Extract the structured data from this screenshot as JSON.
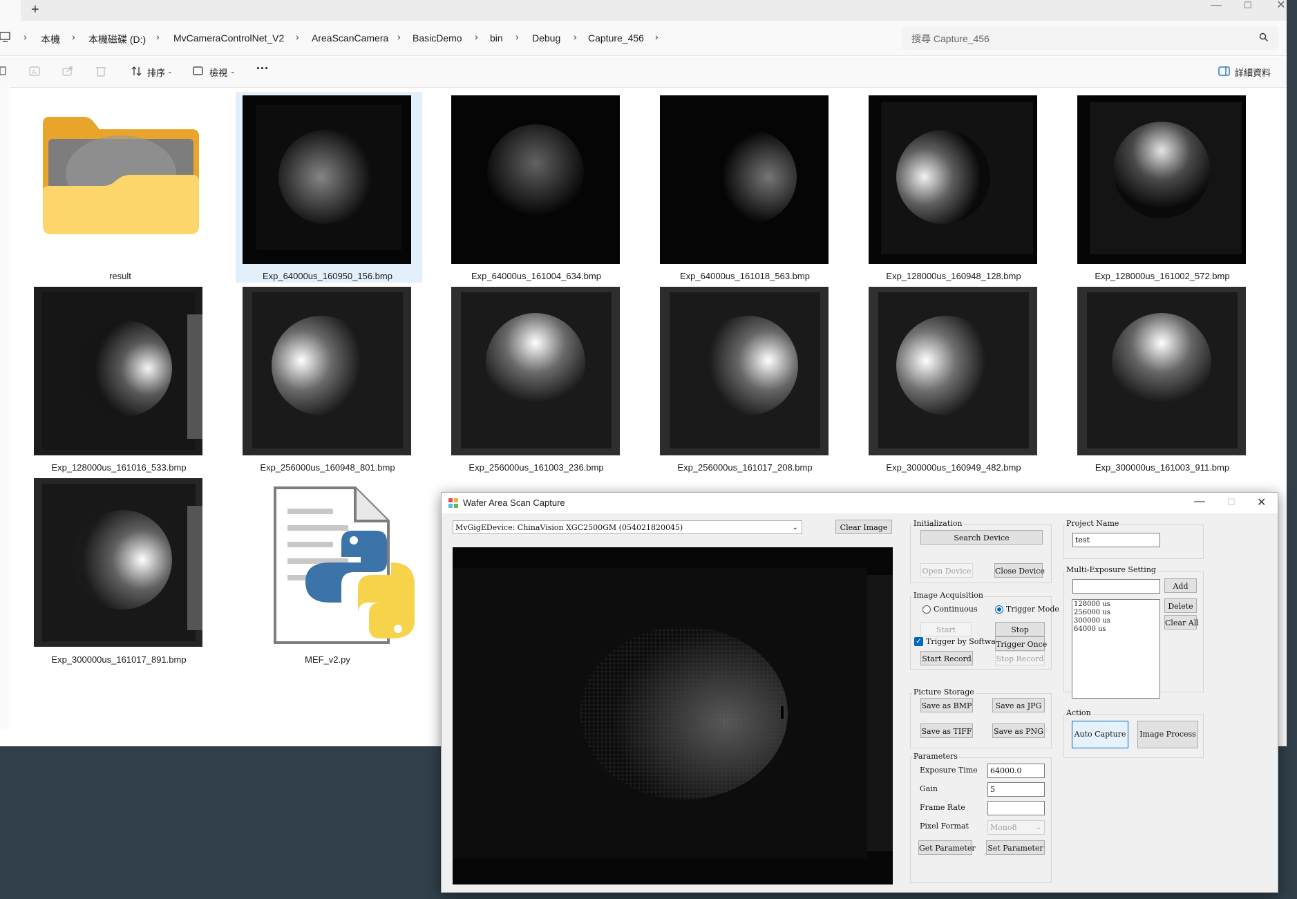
{
  "explorer": {
    "breadcrumb": [
      "本機",
      "本機磁碟 (D:)",
      "MvCameraControlNet_V2",
      "AreaScanCamera",
      "BasicDemo",
      "bin",
      "Debug",
      "Capture_456"
    ],
    "search_placeholder": "搜尋 Capture_456",
    "toolbar": {
      "sort_label": "排序",
      "view_label": "檢視",
      "more_label": "···",
      "details_label": "詳細資料"
    },
    "files": [
      {
        "name": "result",
        "kind": "folder"
      },
      {
        "name": "Exp_64000us_160950_156.bmp",
        "kind": "image",
        "brightness": 0.25,
        "selected": true
      },
      {
        "name": "Exp_64000us_161004_634.bmp",
        "kind": "image",
        "brightness": 0.18
      },
      {
        "name": "Exp_64000us_161018_563.bmp",
        "kind": "image",
        "brightness": 0.22
      },
      {
        "name": "Exp_128000us_160948_128.bmp",
        "kind": "image",
        "brightness": 0.45
      },
      {
        "name": "Exp_128000us_161002_572.bmp",
        "kind": "image",
        "brightness": 0.4
      },
      {
        "name": "Exp_128000us_161016_533.bmp",
        "kind": "image",
        "brightness": 0.45
      },
      {
        "name": "Exp_256000us_160948_801.bmp",
        "kind": "image",
        "brightness": 0.6
      },
      {
        "name": "Exp_256000us_161003_236.bmp",
        "kind": "image",
        "brightness": 0.6
      },
      {
        "name": "Exp_256000us_161017_208.bmp",
        "kind": "image",
        "brightness": 0.6
      },
      {
        "name": "Exp_300000us_160949_482.bmp",
        "kind": "image",
        "brightness": 0.65
      },
      {
        "name": "Exp_300000us_161003_911.bmp",
        "kind": "image",
        "brightness": 0.6
      },
      {
        "name": "Exp_300000us_161017_891.bmp",
        "kind": "image",
        "brightness": 0.6
      },
      {
        "name": "MEF_v2.py",
        "kind": "python"
      }
    ]
  },
  "app": {
    "title": "Wafer Area Scan Capture",
    "device_select": "MvGigEDevice: ChinaVision XGC2500GM (054021820045)",
    "clear_image": "Clear Image",
    "initialization": {
      "label": "Initialization",
      "search": "Search Device",
      "open": "Open Device",
      "close": "Close Device"
    },
    "acquisition": {
      "label": "Image Acquisition",
      "continuous": "Continuous",
      "trigger_mode": "Trigger Mode",
      "start": "Start",
      "stop": "Stop",
      "trigger_software": "Trigger by Software",
      "trigger_once": "Trigger Once",
      "start_record": "Start Record",
      "stop_record": "Stop Record"
    },
    "storage": {
      "label": "Picture Storage",
      "bmp": "Save as BMP",
      "jpg": "Save as JPG",
      "tiff": "Save as TIFF",
      "png": "Save as PNG"
    },
    "parameters": {
      "label": "Parameters",
      "exposure_label": "Exposure Time",
      "exposure_value": "64000.0",
      "gain_label": "Gain",
      "gain_value": "5",
      "frame_rate_label": "Frame Rate",
      "frame_rate_value": "",
      "pixel_format_label": "Pixel Format",
      "pixel_format_value": "Mono8",
      "get": "Get Parameter",
      "set": "Set Parameter"
    },
    "project": {
      "label": "Project Name",
      "value": "test"
    },
    "multi_exposure": {
      "label": "Multi-Exposure Setting",
      "input_value": "",
      "add": "Add",
      "delete": "Delete",
      "clear_all": "Clear All",
      "items": [
        "128000 us",
        "256000 us",
        "300000 us",
        "64000 us"
      ]
    },
    "action": {
      "label": "Action",
      "auto_capture": "Auto Capture",
      "image_process": "Image Process"
    }
  },
  "colors": {
    "accent": "#0067c0",
    "selection": "#cce4f7",
    "desktop": "#303f49"
  }
}
